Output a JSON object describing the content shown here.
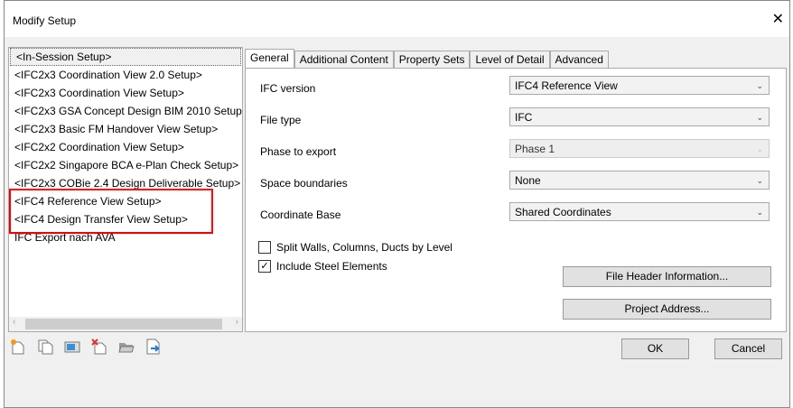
{
  "window": {
    "title": "Modify Setup",
    "close": "✕"
  },
  "setups": [
    "<In-Session Setup>",
    "<IFC2x3 Coordination View 2.0 Setup>",
    "<IFC2x3 Coordination View Setup>",
    "<IFC2x3 GSA Concept Design BIM 2010 Setup>",
    "<IFC2x3 Basic FM Handover View Setup>",
    "<IFC2x2 Coordination View Setup>",
    "<IFC2x2 Singapore BCA e-Plan Check Setup>",
    "<IFC2x3 COBie 2.4 Design Deliverable Setup>",
    "<IFC4 Reference View Setup>",
    "<IFC4 Design Transfer View Setup>",
    "IFC Export nach AVA"
  ],
  "tabs": [
    "General",
    "Additional Content",
    "Property Sets",
    "Level of Detail",
    "Advanced"
  ],
  "fields": {
    "ifc_version": {
      "label": "IFC version",
      "value": "IFC4 Reference View"
    },
    "file_type": {
      "label": "File type",
      "value": "IFC"
    },
    "phase": {
      "label": "Phase to export",
      "value": "Phase 1"
    },
    "space_boundaries": {
      "label": "Space boundaries",
      "value": "None"
    },
    "coordinate_base": {
      "label": "Coordinate Base",
      "value": "Shared Coordinates"
    }
  },
  "checks": {
    "split": {
      "label": "Split Walls, Columns, Ducts by Level",
      "checked": false
    },
    "steel": {
      "label": "Include Steel Elements",
      "checked": true,
      "mark": "✓"
    }
  },
  "buttons": {
    "file_header": "File Header Information...",
    "project_address": "Project Address...",
    "ok": "OK",
    "cancel": "Cancel"
  },
  "scroll": {
    "left": "‹",
    "right": "›"
  },
  "chevron": "⌄"
}
